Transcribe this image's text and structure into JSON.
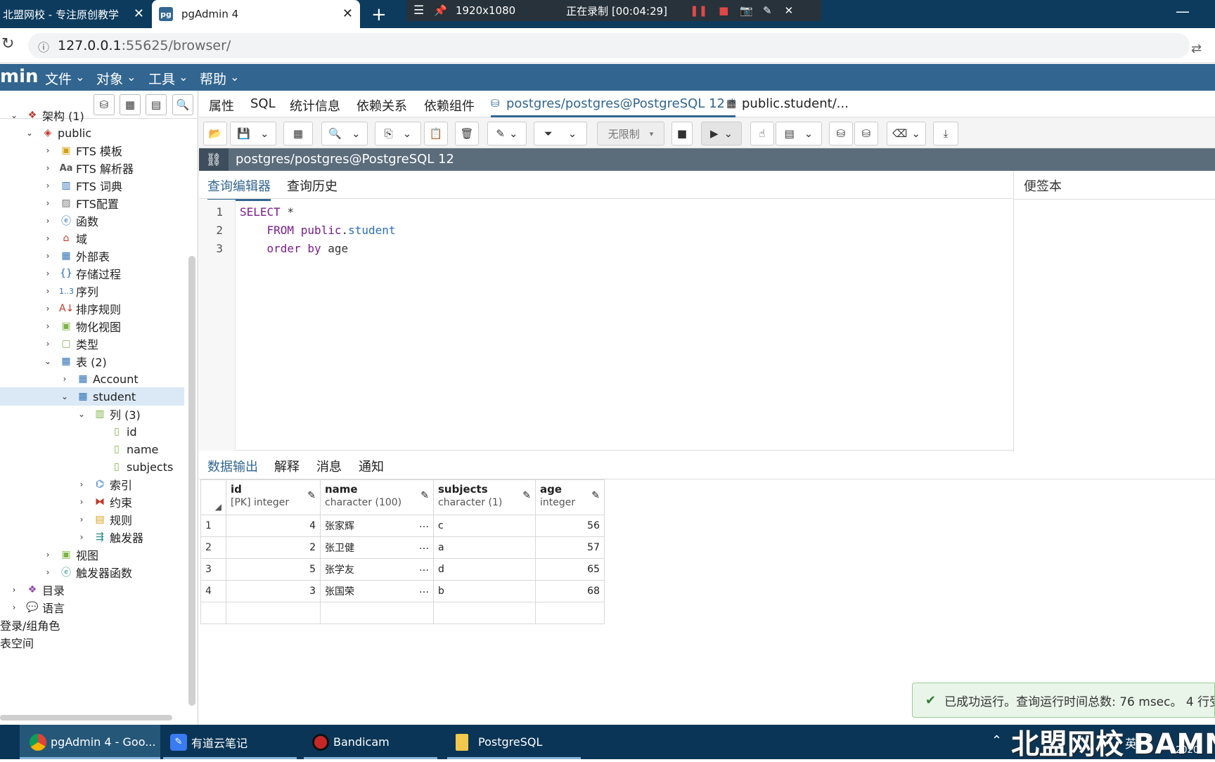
{
  "browser": {
    "tabs": [
      {
        "label": "北盟网校 - 专注原创教学"
      },
      {
        "label": "pgAdmin 4",
        "favicon": "pg"
      }
    ],
    "recorder": {
      "resolution": "1920x1080",
      "status": "正在录制 [00:04:29]"
    },
    "url": {
      "host": "127.0.0.1",
      "rest": ":55625/browser/"
    }
  },
  "app": {
    "logo": "min",
    "menu": [
      "文件",
      "对象",
      "工具",
      "帮助"
    ]
  },
  "tree": {
    "nodes": [
      {
        "label": "架构 (1)",
        "icon": "schema-icon"
      },
      {
        "label": "public",
        "icon": "schema-public-icon"
      },
      {
        "label": "FTS 模板",
        "icon": "fts-template-icon"
      },
      {
        "label": "FTS 解析器",
        "icon": "fts-parser-icon"
      },
      {
        "label": "FTS 词典",
        "icon": "fts-dictionary-icon"
      },
      {
        "label": "FTS配置",
        "icon": "fts-config-icon"
      },
      {
        "label": "函数",
        "icon": "function-icon"
      },
      {
        "label": "域",
        "icon": "domain-icon"
      },
      {
        "label": "外部表",
        "icon": "foreign-table-icon"
      },
      {
        "label": "存储过程",
        "icon": "procedure-icon"
      },
      {
        "label": "序列",
        "icon": "sequence-icon"
      },
      {
        "label": "排序规则",
        "icon": "collation-icon"
      },
      {
        "label": "物化视图",
        "icon": "mview-icon"
      },
      {
        "label": "类型",
        "icon": "type-icon"
      },
      {
        "label": "表 (2)",
        "icon": "tables-icon"
      },
      {
        "label": "Account",
        "icon": "table-icon"
      },
      {
        "label": "student",
        "icon": "table-icon"
      },
      {
        "label": "列 (3)",
        "icon": "columns-icon"
      },
      {
        "label": "id",
        "icon": "column-icon"
      },
      {
        "label": "name",
        "icon": "column-icon"
      },
      {
        "label": "subjects",
        "icon": "column-icon"
      },
      {
        "label": "索引",
        "icon": "index-icon"
      },
      {
        "label": "约束",
        "icon": "constraint-icon"
      },
      {
        "label": "规则",
        "icon": "rule-icon"
      },
      {
        "label": "触发器",
        "icon": "trigger-icon"
      },
      {
        "label": "视图",
        "icon": "view-icon"
      },
      {
        "label": "触发器函数",
        "icon": "trigger-function-icon"
      },
      {
        "label": "目录",
        "icon": "catalog-icon"
      },
      {
        "label": "语言",
        "icon": "language-icon"
      },
      {
        "label": "登录/组角色",
        "icon": "role-icon"
      },
      {
        "label": "表空间",
        "icon": "tablespace-icon"
      }
    ]
  },
  "main": {
    "tabs": [
      "属性",
      "SQL",
      "统计信息",
      "依赖关系",
      "依赖组件",
      "postgres/postgres@PostgreSQL 12 *",
      "public.student/..."
    ],
    "limit": "无限制",
    "connection": "postgres/postgres@PostgreSQL 12",
    "editor_tabs": [
      "查询编辑器",
      "查询历史"
    ],
    "scratch": "便签本",
    "sql": {
      "line1": {
        "kw": "SELECT",
        "rest": " *"
      },
      "line2": {
        "kw": "FROM",
        "schema": "public",
        "table": "student"
      },
      "line3": {
        "kw": "order by",
        "rest": " age"
      }
    },
    "result_tabs": [
      "数据输出",
      "解释",
      "消息",
      "通知"
    ],
    "columns": [
      {
        "name": "id",
        "type": "[PK] integer"
      },
      {
        "name": "name",
        "type": "character (100)"
      },
      {
        "name": "subjects",
        "type": "character (1)"
      },
      {
        "name": "age",
        "type": "integer"
      }
    ],
    "rows": [
      {
        "n": "1",
        "id": "4",
        "name": "张家辉",
        "subjects": "c",
        "age": "56"
      },
      {
        "n": "2",
        "id": "2",
        "name": "张卫健",
        "subjects": "a",
        "age": "57"
      },
      {
        "n": "3",
        "id": "5",
        "name": "张学友",
        "subjects": "d",
        "age": "65"
      },
      {
        "n": "4",
        "id": "3",
        "name": "张国荣",
        "subjects": "b",
        "age": "68"
      }
    ],
    "toast": "已成功运行。查询运行时间总数: 76 msec。 4 行受"
  },
  "taskbar": {
    "items": [
      "pgAdmin 4 - Goo...",
      "有道云笔记",
      "Bandicam",
      "PostgreSQL"
    ],
    "watermark": "北盟网校 BAMN",
    "ime": "英",
    "clock": "2020/"
  }
}
